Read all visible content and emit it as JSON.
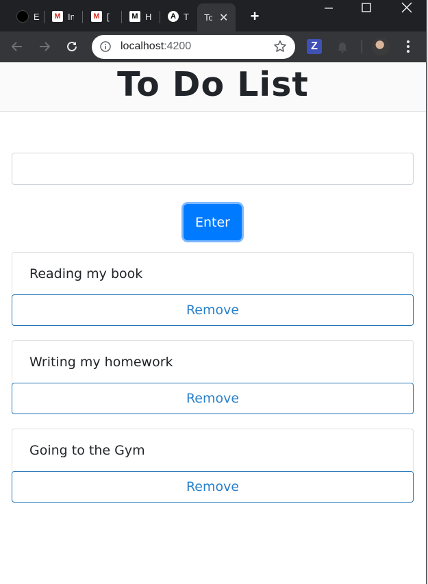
{
  "browser": {
    "tabs": [
      {
        "title": "E",
        "icon": "github-icon"
      },
      {
        "title": "In",
        "icon": "gmail-icon"
      },
      {
        "title": "[",
        "icon": "gmail-icon"
      },
      {
        "title": "H",
        "icon": "medium-icon"
      },
      {
        "title": "T",
        "icon": "angular-icon"
      }
    ],
    "active_tab": {
      "title": "To Do List",
      "icon": "angular-icon"
    },
    "url_host": "localhost",
    "url_port": ":4200",
    "extension_label": "Z"
  },
  "page": {
    "title": "To Do List",
    "input": {
      "value": "",
      "placeholder": ""
    },
    "enter_label": "Enter",
    "todos": [
      {
        "text": "Reading my book",
        "remove_label": "Remove"
      },
      {
        "text": "Writing my homework",
        "remove_label": "Remove"
      },
      {
        "text": "Going to the Gym",
        "remove_label": "Remove"
      }
    ]
  },
  "colors": {
    "primary": "#007bff",
    "remove_border": "#1f73b7",
    "remove_text": "#2a80c9",
    "chrome_dark": "#202124",
    "chrome_toolbar": "#35363a"
  }
}
